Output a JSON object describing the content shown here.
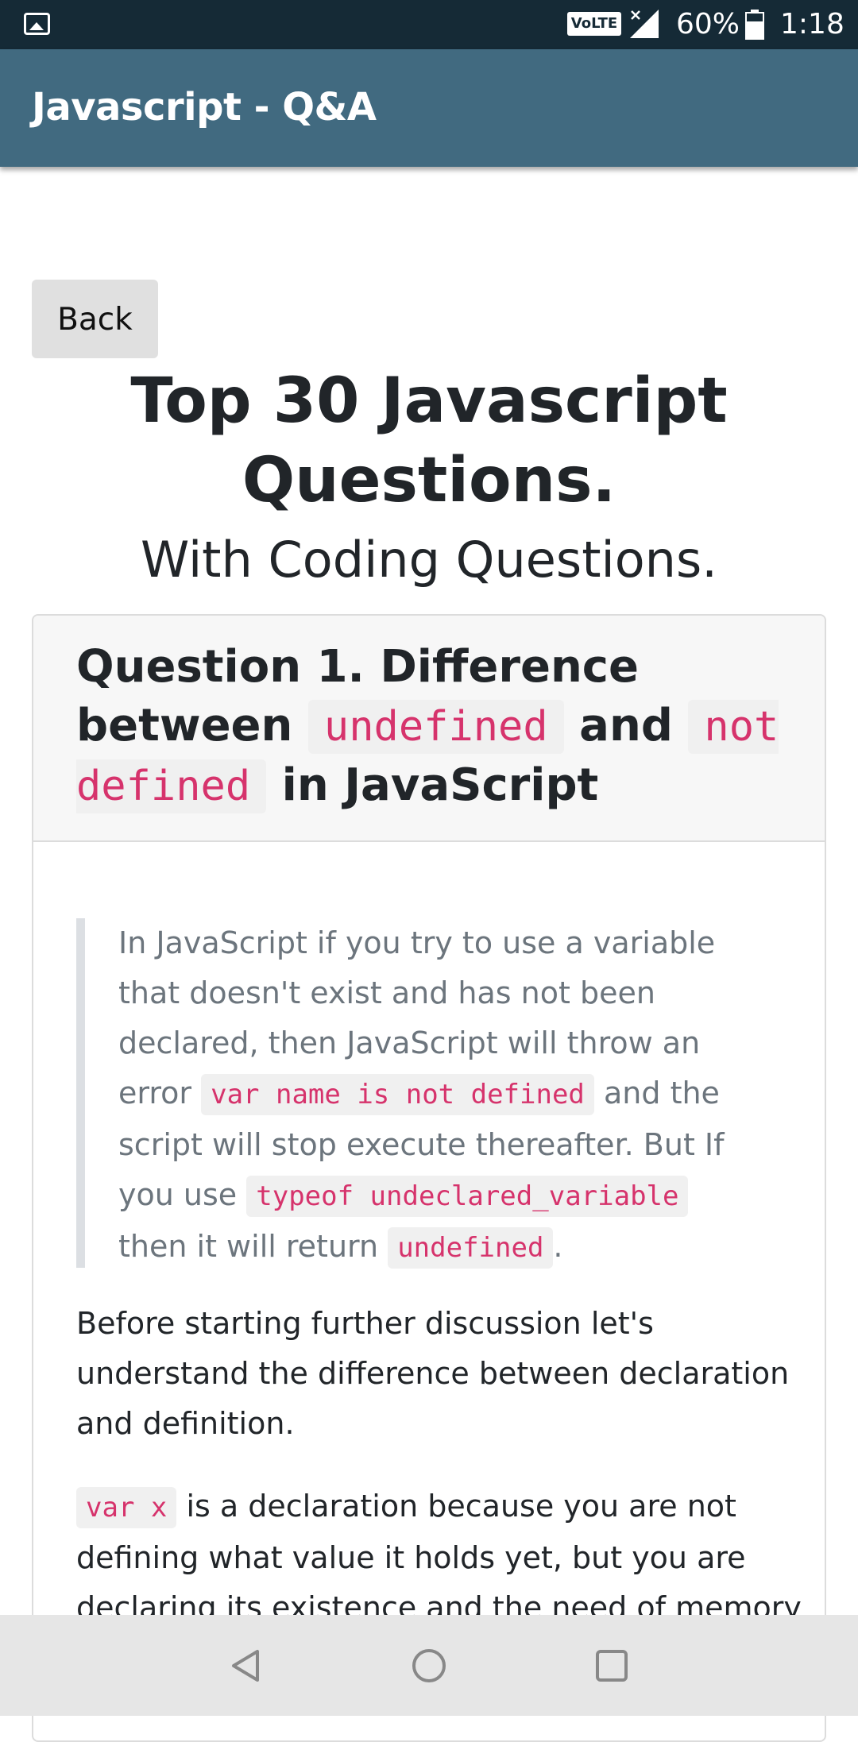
{
  "status_bar": {
    "volte": "VoLTE",
    "battery": "60%",
    "time": "1:18"
  },
  "app_bar": {
    "title": "Javascript - Q&A"
  },
  "content": {
    "back_label": "Back",
    "title": "Top 30 Javascript Questions.",
    "subtitle": "With Coding Questions.",
    "question": {
      "prefix": "Question 1. Difference between",
      "code1": "undefined",
      "mid": "and",
      "code2": "not defined",
      "suffix": "in JavaScript"
    },
    "quote": {
      "t1": "In JavaScript if you try to use a variable that doesn't exist and has not been declared, then JavaScript will throw an error",
      "c1": "var name is not defined",
      "t2": "and the script will stop execute thereafter. But If you use",
      "c2": "typeof undeclared_variable",
      "t3": "then it will return",
      "c3": "undefined",
      "t4": "."
    },
    "para1": "Before starting further discussion let's understand the difference between declaration and definition.",
    "para2": {
      "code": "var x",
      "text": "is a declaration because you are not defining what value it holds yet, but you are declaring its existence and the need of memory"
    }
  },
  "nav_bar": {
    "back_icon": "triangle-back-icon",
    "home_icon": "circle-home-icon",
    "recents_icon": "square-recents-icon"
  }
}
